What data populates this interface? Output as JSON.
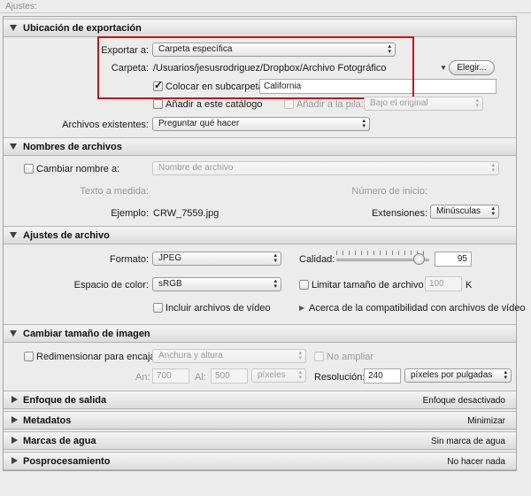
{
  "top_label": "Ajustes:",
  "sections": {
    "export_location": {
      "title": "Ubicación de exportación",
      "export_to_label": "Exportar a:",
      "export_to_value": "Carpeta específica",
      "folder_label": "Carpeta:",
      "folder_path": "/Usuarios/jesusrodriguez/Dropbox/Archivo Fotográfico",
      "choose_button": "Elegir...",
      "subfolder_label": "Colocar en subcarpeta:",
      "subfolder_checked": true,
      "subfolder_value": "California",
      "add_catalog_label": "Añadir a este catálogo",
      "add_stack_label": "Añadir a la pila:",
      "stack_position_value": "Bajo el original",
      "existing_files_label": "Archivos existentes:",
      "existing_files_value": "Preguntar qué hacer"
    },
    "file_naming": {
      "title": "Nombres de archivos",
      "rename_label": "Cambiar nombre a:",
      "rename_value": "Nombre de archivo",
      "custom_text_label": "Texto a medida:",
      "start_number_label": "Número de inicio:",
      "example_label": "Ejemplo:",
      "example_value": "CRW_7559.jpg",
      "extensions_label": "Extensiones:",
      "extensions_value": "Minúsculas"
    },
    "file_settings": {
      "title": "Ajustes de archivo",
      "format_label": "Formato:",
      "format_value": "JPEG",
      "quality_label": "Calidad:",
      "quality_value": "95",
      "quality_fraction": 0.95,
      "color_space_label": "Espacio de color:",
      "color_space_value": "sRGB",
      "limit_size_label": "Limitar tamaño de archivo a:",
      "limit_size_value": "100",
      "limit_size_unit": "K",
      "include_video_label": "Incluir archivos de vídeo",
      "video_compat_label": "Acerca de la compatibilidad con archivos de vídeo"
    },
    "image_sizing": {
      "title": "Cambiar tamaño de imagen",
      "resize_label": "Redimensionar para encajar:",
      "resize_value": "Anchura y altura",
      "dont_enlarge_label": "No ampliar",
      "width_label": "An:",
      "width_value": "700",
      "height_label": "Al:",
      "height_value": "500",
      "units_value": "píxeles",
      "resolution_label": "Resolución:",
      "resolution_value": "240",
      "resolution_units_value": "píxeles por pulgadas"
    },
    "output_sharpening": {
      "title": "Enfoque de salida",
      "summary": "Enfoque desactivado"
    },
    "metadata": {
      "title": "Metadatos",
      "summary": "Minimizar"
    },
    "watermarking": {
      "title": "Marcas de agua",
      "summary": "Sin marca de agua"
    },
    "post_processing": {
      "title": "Posprocesamiento",
      "summary": "No hacer nada"
    }
  },
  "colors": {
    "highlight_box": "#c91317",
    "panel_bg": "#ececec"
  },
  "icons": {
    "expanded": "disclosure-triangle-down-icon",
    "collapsed": "disclosure-triangle-right-icon",
    "popup": "popup-arrows-icon",
    "checkbox": "checkmark-icon"
  }
}
